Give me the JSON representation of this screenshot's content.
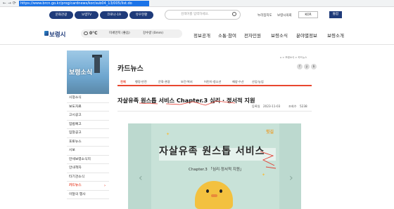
{
  "browser": {
    "url": "https://www.brcn.go.kr/prog/cardnews/kor/sub04_13/005/list.do"
  },
  "topbar": {
    "pills": [
      "문화관광",
      "보령TV",
      "코로나-19",
      "유우현황"
    ],
    "search_placeholder": "검색어를 입력하세요.",
    "links": [
      "누리집지도",
      "보령시의회"
    ],
    "lang": "KOR",
    "jump_button": "통합"
  },
  "header": {
    "logo": "보령시",
    "temperature": "0°C",
    "weather_1": "미세먼지 (좋음)",
    "weather_2": "강수량 (0mm)",
    "menu": [
      "정보공개",
      "소통·참여",
      "전자민원",
      "보령소식",
      "분야별정보",
      "보령소개"
    ]
  },
  "sidebar": {
    "banner_title": "보령소식",
    "items": [
      "시정소식",
      "보도자료",
      "고시공고",
      "입법예고",
      "입찰공고",
      "포토뉴스",
      "시보",
      "만세보령소식지",
      "안내책자",
      "타기관소식",
      "카드뉴스",
      "이달의 행사"
    ],
    "active_index": 10,
    "active_arrow": "›"
  },
  "content": {
    "breadcrumb": "⌂ > 보령소식 > 카드뉴스",
    "title": "카드뉴스",
    "share_icons": [
      "f",
      "y",
      "b"
    ],
    "tabs": [
      "전체",
      "행정·안전",
      "문화·관광",
      "보건·복지",
      "어린이·청소년",
      "해양·수산",
      "산업·농업"
    ],
    "active_tab": 0,
    "article_title": "자살유족 원스톱 서비스 Chapter.3 심리 · 정서적 지원",
    "date_label": "등록일",
    "date": "2023-11-03",
    "views_label": "조회수",
    "views": "5238"
  },
  "card": {
    "brand": "힛길",
    "headline": "자살유족 원스톱 서비스",
    "subtitle": "Chapter.3 「심리·정서적 지원」",
    "prev": "‹",
    "next": "›"
  },
  "colors": {
    "navy": "#1f3b7a",
    "accent": "#e8462f",
    "card_bg": "#c8e2d8"
  }
}
